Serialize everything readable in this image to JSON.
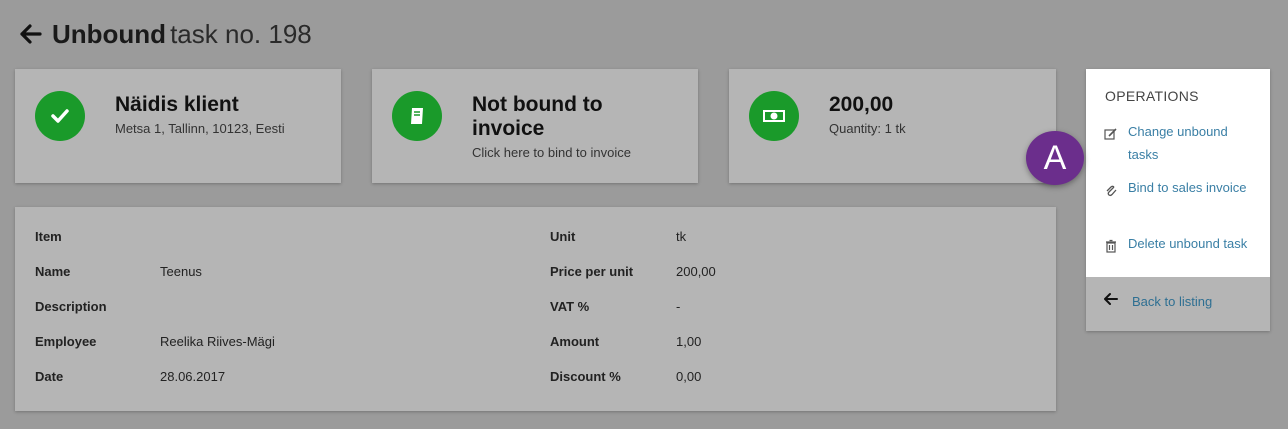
{
  "header": {
    "title_bold": "Unbound",
    "title_rest": "task no. 198"
  },
  "cards": {
    "client": {
      "name": "Näidis klient",
      "address": "Metsa 1, Tallinn, 10123, Eesti"
    },
    "invoice": {
      "status": "Not bound to invoice",
      "hint": "Click here to bind to invoice"
    },
    "amount": {
      "value": "200,00",
      "quantity": "Quantity: 1 tk"
    }
  },
  "details": {
    "left": [
      {
        "label": "Item",
        "value": ""
      },
      {
        "label": "Name",
        "value": "Teenus"
      },
      {
        "label": "Description",
        "value": ""
      },
      {
        "label": "Employee",
        "value": "Reelika Riives-Mägi"
      },
      {
        "label": "Date",
        "value": "28.06.2017"
      }
    ],
    "right": [
      {
        "label": "Unit",
        "value": "tk"
      },
      {
        "label": "Price per unit",
        "value": "200,00"
      },
      {
        "label": "VAT %",
        "value": "-"
      },
      {
        "label": "Amount",
        "value": "1,00"
      },
      {
        "label": "Discount %",
        "value": "0,00"
      }
    ]
  },
  "operations": {
    "title": "OPERATIONS",
    "items": [
      {
        "label": "Change unbound tasks",
        "icon": "edit-icon"
      },
      {
        "label": "Bind to sales invoice",
        "icon": "paperclip-icon"
      },
      {
        "label": "Delete unbound task",
        "icon": "trash-icon"
      }
    ],
    "back": "Back to listing"
  },
  "badge": {
    "letter": "A",
    "color": "#6b2e8c"
  },
  "colors": {
    "success": "#1a9a2a",
    "link": "#3a7fa5",
    "background": "#9b9b9b",
    "panel": "#b5b5b5"
  }
}
